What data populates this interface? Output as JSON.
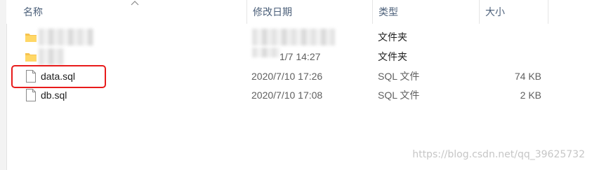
{
  "columns": {
    "name": "名称",
    "modified": "修改日期",
    "type": "类型",
    "size": "大小"
  },
  "rows": [
    {
      "name": "",
      "modified": "",
      "type": "文件夹",
      "size": "",
      "icon": "folder-icon"
    },
    {
      "name": "",
      "modified": "1/7 14:27",
      "type": "文件夹",
      "size": "",
      "icon": "folder-icon"
    },
    {
      "name": "data.sql",
      "modified": "2020/7/10 17:26",
      "type": "SQL 文件",
      "size": "74 KB",
      "icon": "file-icon"
    },
    {
      "name": "db.sql",
      "modified": "2020/7/10 17:08",
      "type": "SQL 文件",
      "size": "2 KB",
      "icon": "file-icon"
    }
  ],
  "watermark": "https://blog.csdn.net/qq_39625732",
  "colors": {
    "header_text": "#4c607a",
    "folder": "#f6c34f",
    "highlight": "#e81b1b"
  }
}
